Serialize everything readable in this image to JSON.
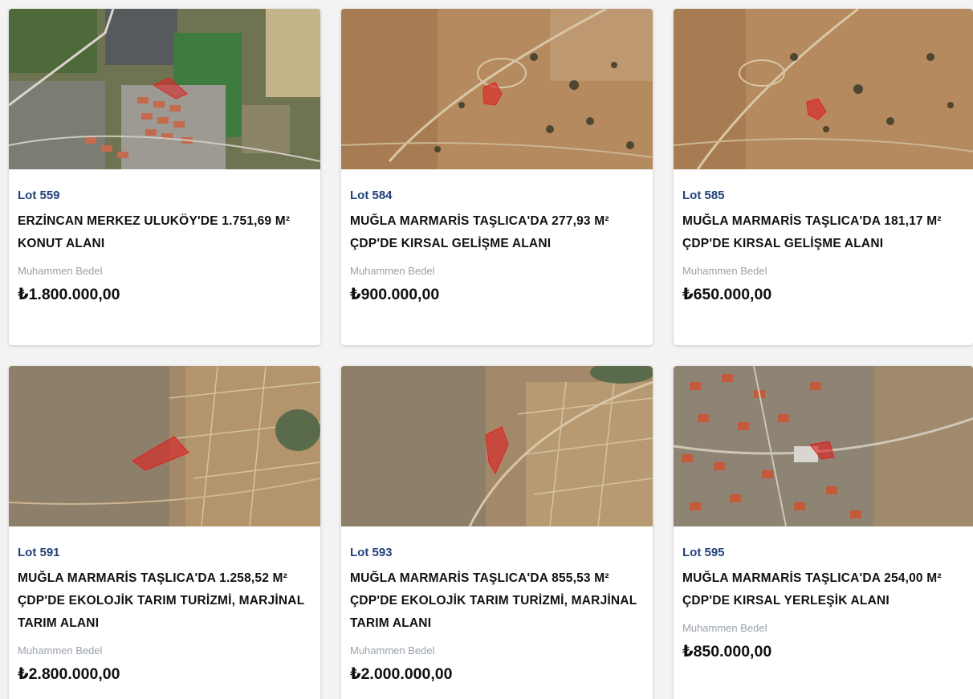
{
  "listings": [
    {
      "lot": "Lot 559",
      "title_line1": "ERZİNCAN MERKEZ ULUKÖY'DE 1.751,69 M²",
      "title_line2": "KONUT ALANI",
      "title_line3": "",
      "label": "Muhammen Bedel",
      "price": "₺1.800.000,00",
      "map_style": "urban-green"
    },
    {
      "lot": "Lot 584",
      "title_line1": "MUĞLA MARMARİS TAŞLICA'DA 277,93 M²",
      "title_line2": "ÇDP'DE KIRSAL GELİŞME ALANI",
      "title_line3": "",
      "label": "Muhammen Bedel",
      "price": "₺900.000,00",
      "map_style": "arid"
    },
    {
      "lot": "Lot 585",
      "title_line1": "MUĞLA MARMARİS TAŞLICA'DA 181,17 M²",
      "title_line2": "ÇDP'DE KIRSAL GELİŞME ALANI",
      "title_line3": "",
      "label": "Muhammen Bedel",
      "price": "₺650.000,00",
      "map_style": "arid"
    },
    {
      "lot": "Lot 591",
      "title_line1": "MUĞLA MARMARİS TAŞLICA'DA 1.258,52 M²",
      "title_line2": "ÇDP'DE EKOLOJİK TARIM TURİZMİ, MARJİNAL",
      "title_line3": "TARIM ALANI",
      "label": "Muhammen Bedel",
      "price": "₺2.800.000,00",
      "map_style": "fields-pond"
    },
    {
      "lot": "Lot 593",
      "title_line1": "MUĞLA MARMARİS TAŞLICA'DA 855,53 M²",
      "title_line2": "ÇDP'DE EKOLOJİK TARIM TURİZMİ, MARJİNAL",
      "title_line3": "TARIM ALANI",
      "label": "Muhammen Bedel",
      "price": "₺2.000.000,00",
      "map_style": "fields"
    },
    {
      "lot": "Lot 595",
      "title_line1": "MUĞLA MARMARİS TAŞLICA'DA 254,00 M²",
      "title_line2": "ÇDP'DE KIRSAL YERLEŞİK ALANI",
      "title_line3": "",
      "label": "Muhammen Bedel",
      "price": "₺850.000,00",
      "map_style": "village"
    }
  ],
  "colors": {
    "lot_text": "#23417a",
    "parcel": "#e02020",
    "label_text": "#9aa1aa"
  }
}
